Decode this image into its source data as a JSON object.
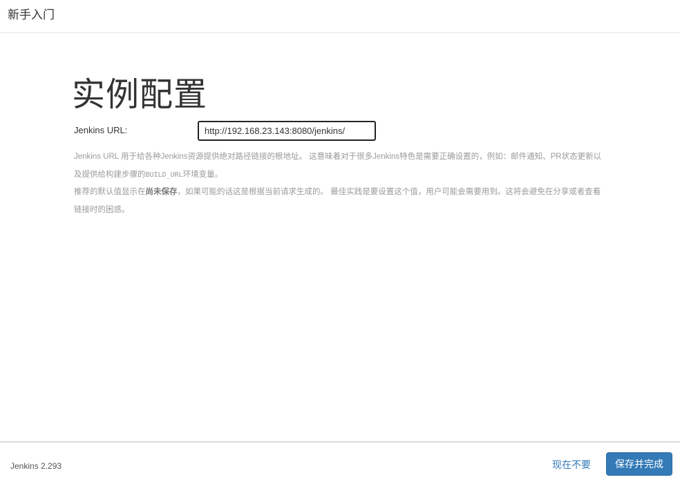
{
  "header": {
    "title": "新手入门"
  },
  "main": {
    "title": "实例配置",
    "jenkins_url_label": "Jenkins URL:",
    "jenkins_url_value": "http://192.168.23.143:8080/jenkins/",
    "help": {
      "p1_part1": "Jenkins URL 用于给各种Jenkins资源提供绝对路径链接的根地址。 这意味着对于很多Jenkins特色是需要正确设置的，例如：邮件通知、PR状态更新以及提供给构建步骤的",
      "p1_code": "BUILD_URL",
      "p1_part2": "环境变量。",
      "p2_part1": "推荐的默认值显示在",
      "p2_strong": "尚未保存",
      "p2_part2": "，如果可能的话这是根据当前请求生成的。 最佳实践是要设置这个值，用户可能会需要用到。这将会避免在分享或者查看链接时的困惑。"
    }
  },
  "footer": {
    "version": "Jenkins 2.293",
    "skip_label": "现在不要",
    "save_label": "保存并完成"
  },
  "colors": {
    "primary": "#337ab7",
    "help_text": "#9a9a9a",
    "border": "#e5e5e5"
  }
}
